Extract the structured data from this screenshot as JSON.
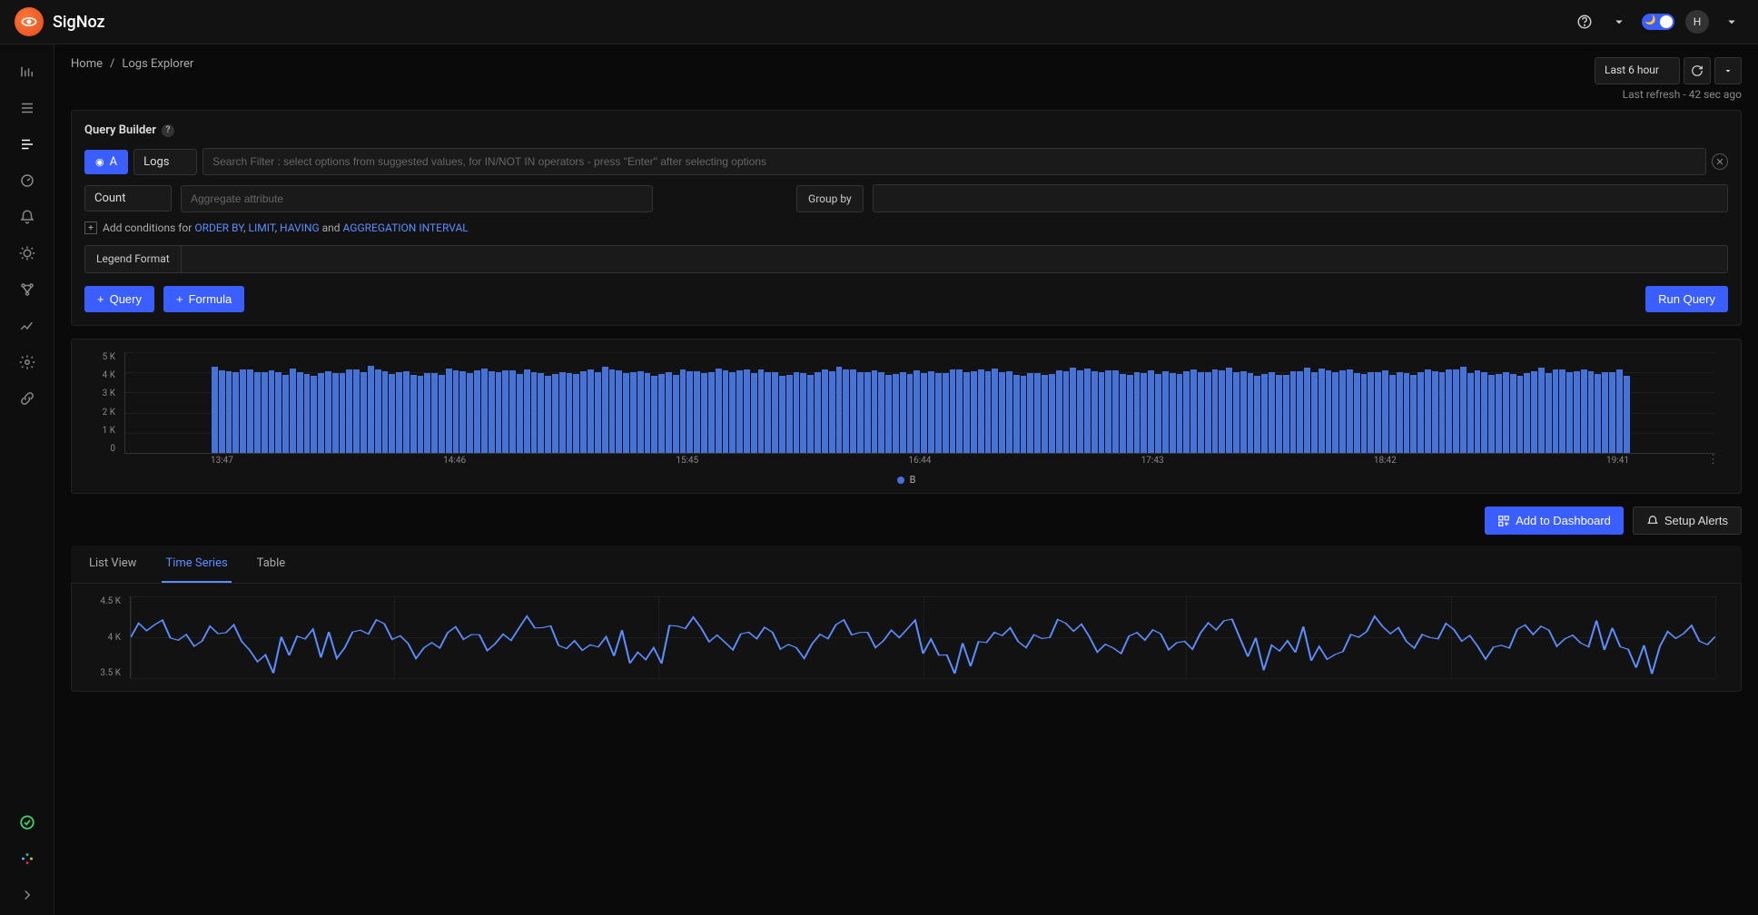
{
  "brand": "SigNoz",
  "breadcrumb": {
    "home": "Home",
    "sep": "/",
    "page": "Logs Explorer"
  },
  "header": {
    "time_range": "Last 6 hour",
    "refresh_text": "Last refresh - 42 sec ago"
  },
  "query_builder": {
    "title": "Query Builder",
    "badge": "A",
    "source": "Logs",
    "search_placeholder": "Search Filter : select options from suggested values, for IN/NOT IN operators - press \"Enter\" after selecting options",
    "agg_func": "Count",
    "agg_placeholder": "Aggregate attribute",
    "group_by_label": "Group by",
    "conditions_prefix": "Add conditions for ",
    "kw_order": "ORDER BY",
    "kw_limit": "LIMIT",
    "kw_having": "HAVING",
    "kw_and": " and ",
    "kw_aggint": "AGGREGATION INTERVAL",
    "comma": ", ",
    "legend_label": "Legend Format",
    "btn_query": "Query",
    "btn_formula": "Formula",
    "btn_run": "Run Query"
  },
  "chart_data": {
    "type": "bar",
    "ylabels": [
      "5 K",
      "4 K",
      "3 K",
      "2 K",
      "1 K",
      "0"
    ],
    "ylim": [
      0,
      5000
    ],
    "xlabels": [
      "13:47",
      "14:46",
      "15:45",
      "16:44",
      "17:43",
      "18:42",
      "19:41"
    ],
    "legend": "B",
    "approx_value": 4000,
    "bar_count": 200
  },
  "actions": {
    "add_dashboard": "Add to Dashboard",
    "setup_alerts": "Setup Alerts"
  },
  "tabs": {
    "list": "List View",
    "timeseries": "Time Series",
    "table": "Table",
    "active": "timeseries"
  },
  "line_chart": {
    "type": "line",
    "ylabels": [
      "4.5 K",
      "4 K",
      "3.5 K"
    ],
    "ylim": [
      3500,
      4500
    ],
    "approx_center": 4000
  },
  "avatar": "H"
}
